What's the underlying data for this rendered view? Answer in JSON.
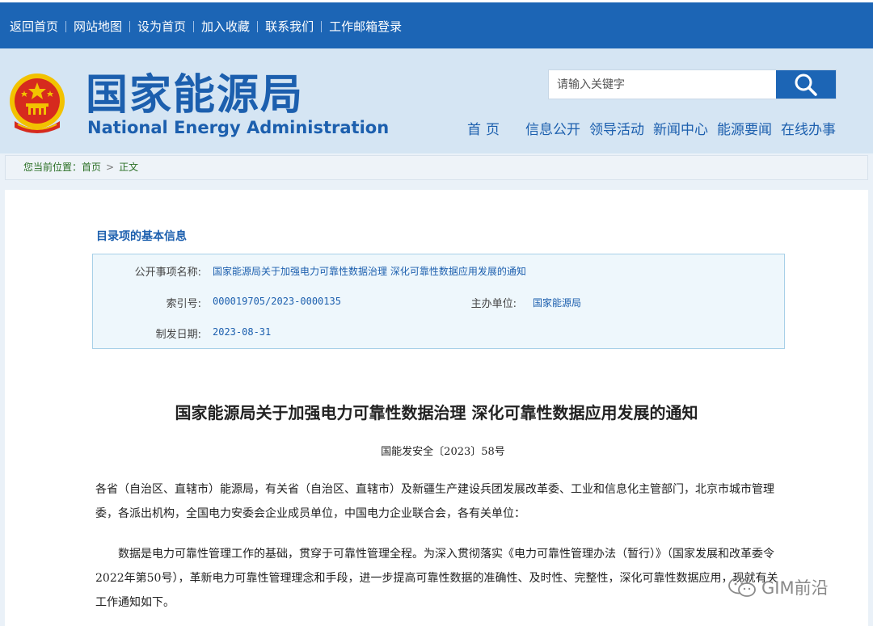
{
  "topbar": {
    "links": [
      "返回首页",
      "网站地图",
      "设为首页",
      "加入收藏",
      "联系我们",
      "工作邮箱登录"
    ]
  },
  "header": {
    "brand_cn": "国家能源局",
    "brand_en": "National Energy Administration",
    "search_placeholder": "请输入关键字",
    "nav": [
      "首页",
      "信息公开",
      "领导活动",
      "新闻中心",
      "能源要闻",
      "在线办事"
    ]
  },
  "breadcrumb": {
    "prefix": "您当前位置：",
    "home": "首页",
    "arrow": ">",
    "current": "正文"
  },
  "info": {
    "title": "目录项的基本信息",
    "rows": {
      "item_name_label": "公开事项名称:",
      "item_name_value": "国家能源局关于加强电力可靠性数据治理 深化可靠性数据应用发展的通知",
      "index_label": "索引号:",
      "index_value": "000019705/2023-0000135",
      "org_label": "主办单位:",
      "org_value": "国家能源局",
      "date_label": "制发日期:",
      "date_value": "2023-08-31"
    }
  },
  "document": {
    "title": "国家能源局关于加强电力可靠性数据治理 深化可靠性数据应用发展的通知",
    "number": "国能发安全〔2023〕58号",
    "paragraphs": [
      "各省（自治区、直辖市）能源局，有关省（自治区、直辖市）及新疆生产建设兵团发展改革委、工业和信息化主管部门，北京市城市管理委，各派出机构，全国电力安委会企业成员单位，中国电力企业联合会，各有关单位：",
      "数据是电力可靠性管理工作的基础，贯穿于可靠性管理全程。为深入贯彻落实《电力可靠性管理办法（暂行）》（国家发展和改革委令2022年第50号），革新电力可靠性管理理念和手段，进一步提高可靠性数据的准确性、及时性、完整性，深化可靠性数据应用，现就有关工作通知如下。"
    ]
  },
  "watermark": {
    "text": "GIM前沿"
  },
  "colors": {
    "brand_blue": "#1c65b5",
    "header_bg": "#d5e5f3",
    "crumb_green": "#2a6f25",
    "emblem_red": "#d62a1e",
    "emblem_gold": "#f2c200"
  }
}
